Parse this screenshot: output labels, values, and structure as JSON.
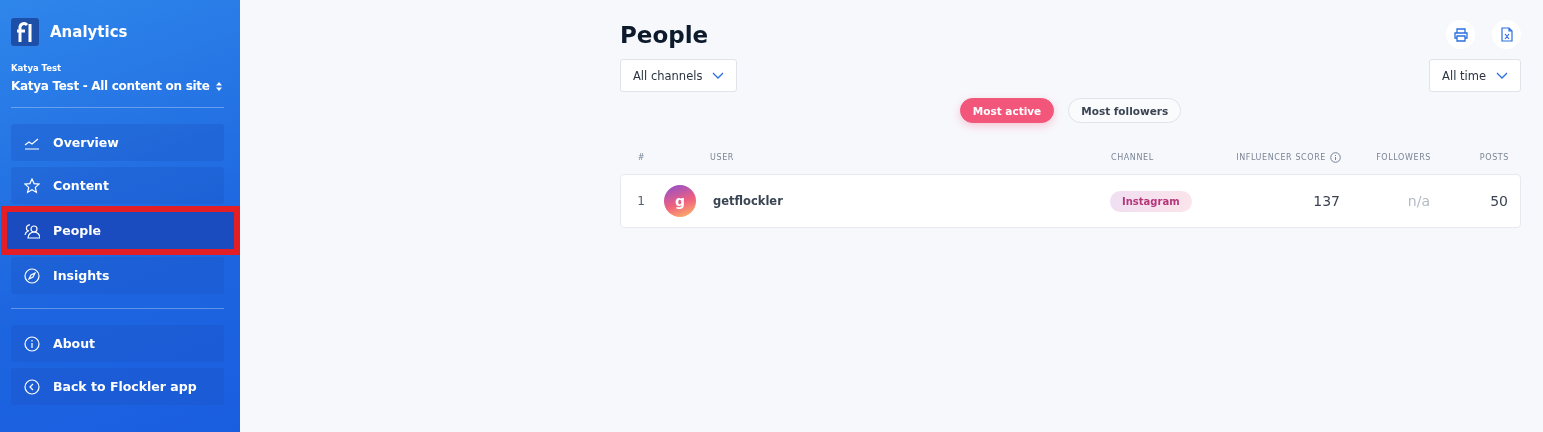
{
  "sidebar": {
    "app_title": "Analytics",
    "account_label": "Katya Test",
    "account_selector": "Katya Test - All content on site",
    "nav_items": [
      {
        "label": "Overview",
        "kind": "chart",
        "selected": false,
        "highlighted": false
      },
      {
        "label": "Content",
        "kind": "star",
        "selected": false,
        "highlighted": false
      },
      {
        "label": "People",
        "kind": "people",
        "selected": true,
        "highlighted": true
      },
      {
        "label": "Insights",
        "kind": "compass",
        "selected": false,
        "highlighted": false
      }
    ],
    "footer_items": [
      {
        "label": "About",
        "kind": "info"
      },
      {
        "label": "Back to Flockler app",
        "kind": "back"
      }
    ]
  },
  "page": {
    "title": "People",
    "channel_filter": "All channels",
    "time_filter": "All time",
    "sort_toggles": [
      {
        "label": "Most active",
        "selected": true
      },
      {
        "label": "Most followers",
        "selected": false
      }
    ],
    "table": {
      "columns": [
        "#",
        "USER",
        "CHANNEL",
        "INFLUENCER SCORE",
        "FOLLOWERS",
        "POSTS"
      ],
      "rows": [
        {
          "rank": "1",
          "avatar": "g",
          "user": "getflockler",
          "channel": "Instagram",
          "score": "137",
          "followers": "n/a",
          "posts": "50"
        }
      ]
    }
  }
}
